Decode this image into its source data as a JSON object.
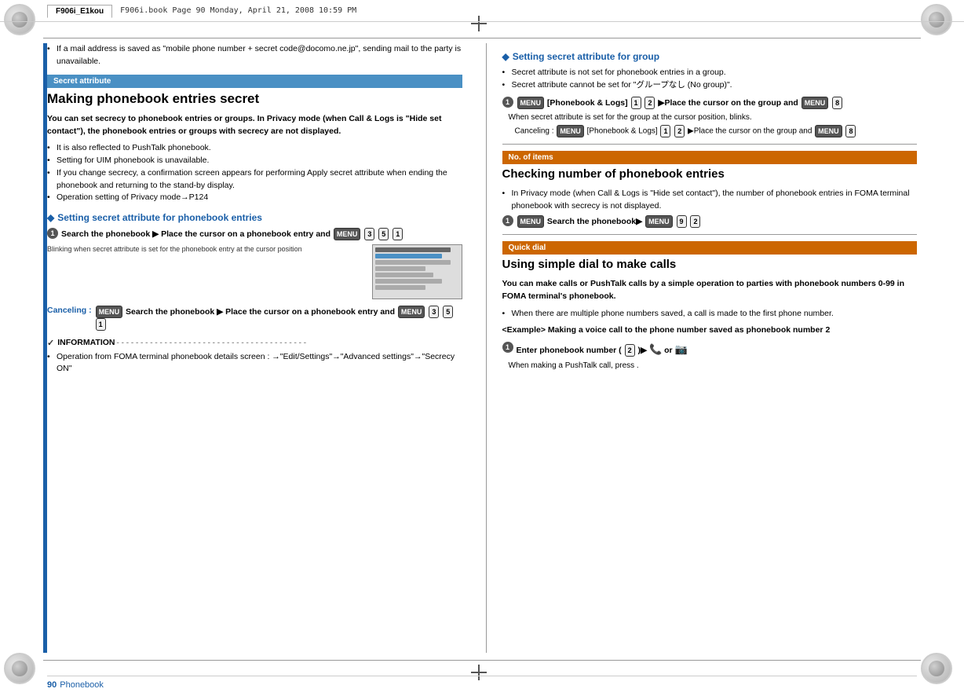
{
  "header": {
    "tab_label": "F906i_E1kou",
    "filename_line": "F906i.book  Page 90  Monday, April 21, 2008  10:59 PM"
  },
  "page": {
    "number": "90",
    "category": "Phonebook"
  },
  "left_col": {
    "intro_bullet": "If a mail address is saved as \"mobile phone number + secret code@docomo.ne.jp\", sending mail to the party is unavailable.",
    "section_header": "Secret attribute",
    "main_heading": "Making phonebook entries secret",
    "body_text_1": "You can set secrecy to phonebook entries or groups. In Privacy mode (when Call & Logs is \"Hide set contact\"), the phonebook entries or groups with secrecy are not displayed.",
    "bullets": [
      "It is also reflected to PushTalk phonebook.",
      "Setting for UIM phonebook is unavailable.",
      "If you change secrecy, a confirmation screen appears for performing Apply secret attribute when ending the phonebook and returning to the stand-by display.",
      "Operation setting of Privacy mode→P124"
    ],
    "diamond_heading": "Setting secret attribute for phonebook entries",
    "step1_content": "Search the phonebook▶Place the cursor on a phonebook entry and ",
    "step1_keys": [
      "3",
      "5",
      "1"
    ],
    "annotation_text": "Blinking when secret attribute is set for the phonebook entry at the cursor position",
    "canceling_label": "Canceling :",
    "canceling_content": "Search the phonebook▶Place the cursor on a phonebook entry and ",
    "canceling_keys": [
      "3",
      "5",
      "1"
    ],
    "info_header": "INFORMATION",
    "info_bullet": "Operation from FOMA terminal phonebook details screen : →\"Edit/Settings\"→\"Advanced settings\"→\"Secrecy ON\""
  },
  "right_col": {
    "diamond_heading_group": "Setting secret attribute for group",
    "group_bullets": [
      "Secret attribute is not set for phonebook entries in a group.",
      "Secret attribute cannot be set for \"グループなし (No group)\"."
    ],
    "step1_content_group": "[Phonebook & Logs] ▶Place the cursor on the group and ",
    "step1_keys_group": [
      "1",
      "2"
    ],
    "step1_key_end": "8",
    "when_note": "When secret attribute is set for the group at the cursor position,  blinks.",
    "canceling_label_group": "Canceling :",
    "canceling_content_group": "[Phonebook & Logs] ▶Place the cursor on the group and ",
    "canceling_keys_group": [
      "1",
      "2"
    ],
    "canceling_key_end": "8",
    "section_header_items": "No. of items",
    "heading_items": "Checking number of phonebook entries",
    "items_body": "In Privacy mode (when Call & Logs is \"Hide set contact\"), the number of phonebook entries in FOMA terminal phonebook with secrecy is not displayed.",
    "step1_items": "Search the phonebook▶",
    "step1_items_keys": [
      "9",
      "2"
    ],
    "section_header_quick": "Quick dial",
    "heading_quick": "Using simple dial to make calls",
    "quick_body": "You can make calls or PushTalk calls by a simple operation to parties with phonebook numbers 0-99 in FOMA terminal's phonebook.",
    "quick_bullets": [
      "When there are multiple phone numbers saved, a call is made to the first phone number."
    ],
    "example_heading": "<Example> Making a voice call to the phone number saved as phonebook number 2",
    "step1_quick": "Enter phonebook number (",
    "step1_quick_key": "2",
    "step1_quick_end": ")▶  or  ",
    "step1_quick_note": "When making a PushTalk call, press ."
  }
}
